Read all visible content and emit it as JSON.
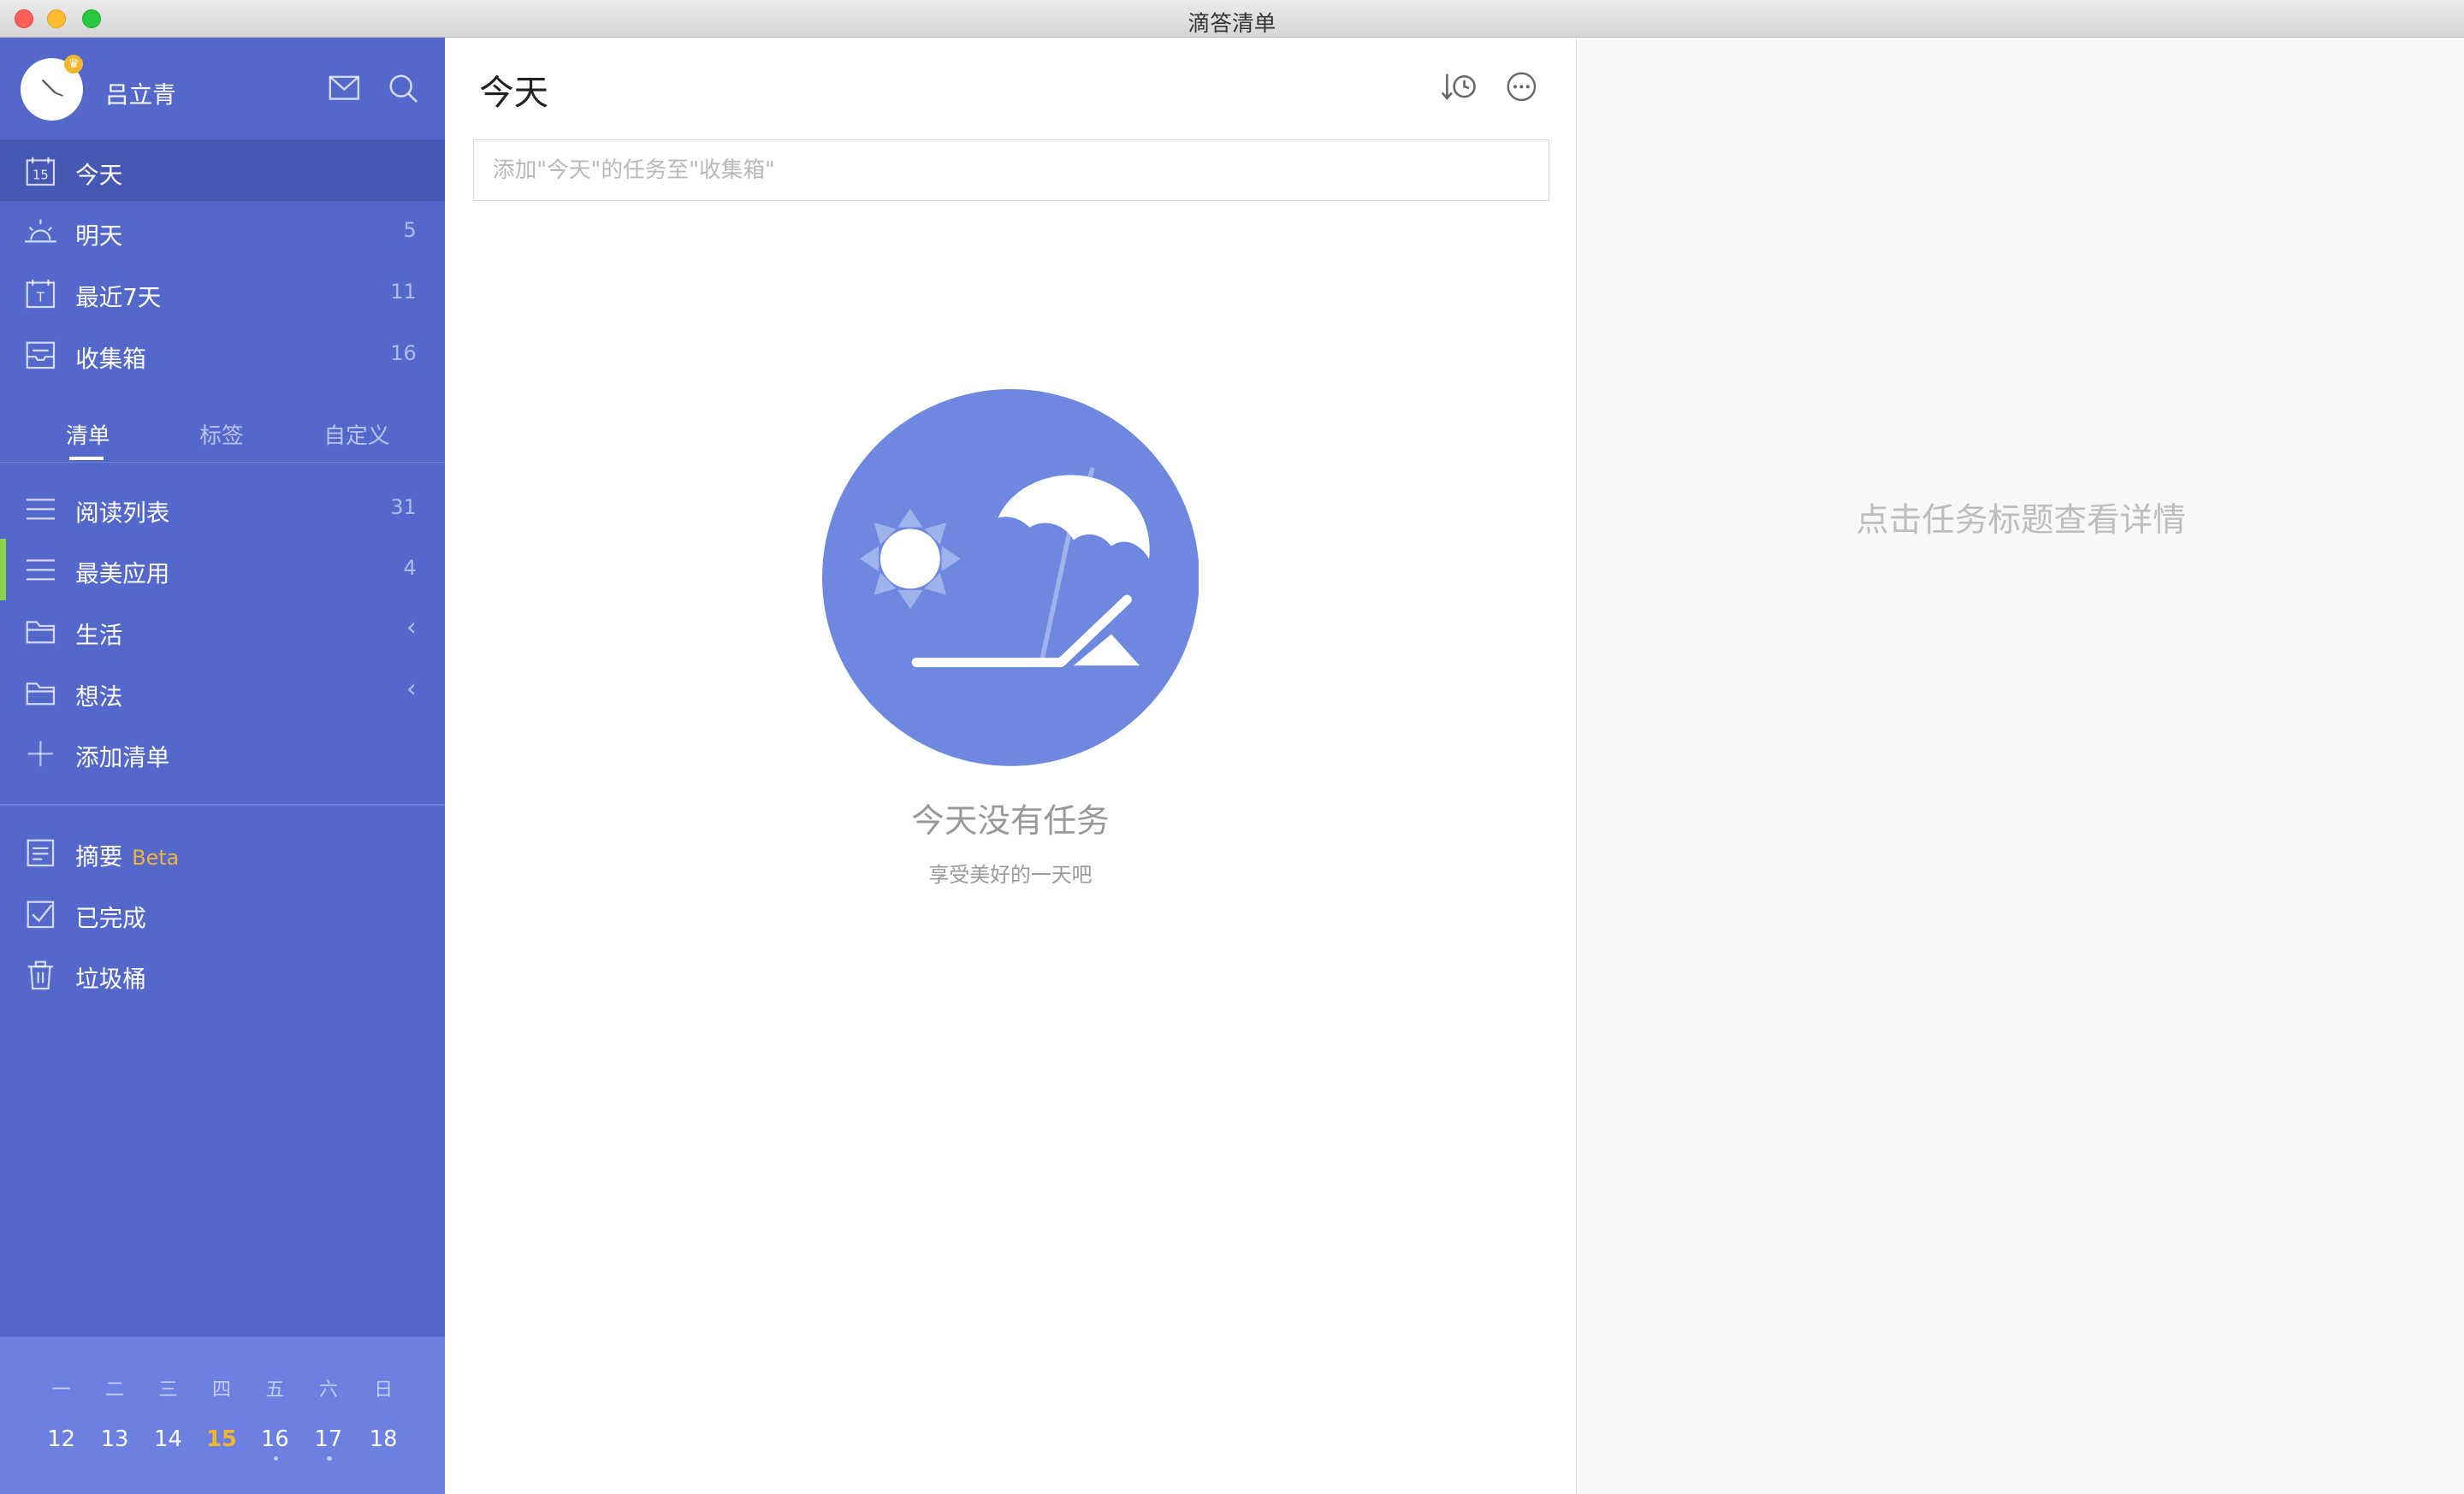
{
  "window": {
    "title": "滴答清单"
  },
  "profile": {
    "username": "吕立青"
  },
  "smart_lists": [
    {
      "label": "今天",
      "count": "",
      "icon": "calendar-day-icon"
    },
    {
      "label": "明天",
      "count": "5",
      "icon": "sunrise-icon"
    },
    {
      "label": "最近7天",
      "count": "11",
      "icon": "calendar-week-icon"
    },
    {
      "label": "收集箱",
      "count": "16",
      "icon": "inbox-icon"
    }
  ],
  "tabs": [
    "清单",
    "标签",
    "自定义"
  ],
  "lists": [
    {
      "label": "阅读列表",
      "count": "31",
      "icon": "list-icon"
    },
    {
      "label": "最美应用",
      "count": "4",
      "icon": "list-icon"
    },
    {
      "label": "生活",
      "icon": "folder-icon",
      "chevron": "‹"
    },
    {
      "label": "想法",
      "icon": "folder-icon",
      "chevron": "‹"
    },
    {
      "label": "添加清单",
      "icon": "plus-icon"
    }
  ],
  "extras": [
    {
      "label": "摘要",
      "badge": "Beta",
      "icon": "summary-icon"
    },
    {
      "label": "已完成",
      "icon": "checkbox-icon"
    },
    {
      "label": "垃圾桶",
      "icon": "trash-icon"
    }
  ],
  "calendar": {
    "weekdays": [
      "一",
      "二",
      "三",
      "四",
      "五",
      "六",
      "日"
    ],
    "days": [
      "12",
      "13",
      "14",
      "15",
      "16",
      "17",
      "18"
    ],
    "today": "15"
  },
  "main": {
    "title": "今天",
    "add_placeholder": "添加\"今天\"的任务至\"收集箱\"",
    "empty_title": "今天没有任务",
    "empty_subtitle": "享受美好的一天吧"
  },
  "detail": {
    "hint": "点击任务标题查看详情"
  },
  "colors": {
    "sidebar": "#5468cc",
    "active": "#4658b3",
    "accent": "#8bd44a",
    "today": "#f5b62a",
    "illustration": "#6e88e0"
  }
}
